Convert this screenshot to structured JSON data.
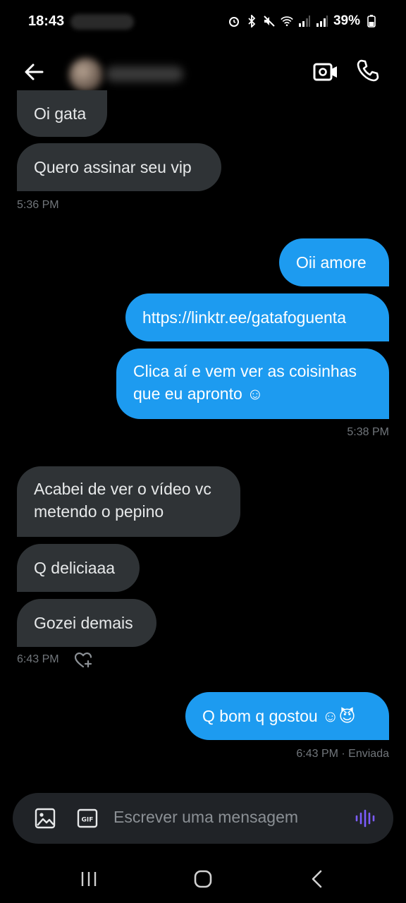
{
  "status_bar": {
    "time": "18:43",
    "battery": "39%"
  },
  "header": {
    "contact_name": ""
  },
  "messages": [
    {
      "dir": "in",
      "text": "Oi gata"
    },
    {
      "dir": "in",
      "text": "Quero assinar seu vip",
      "time": "5:36 PM"
    },
    {
      "dir": "out",
      "text": "Oii amore"
    },
    {
      "dir": "out",
      "text": "https://linktr.ee/gatafoguenta"
    },
    {
      "dir": "out",
      "lines": [
        "Clica aí e vem ver as coisinhas",
        "que eu apronto ☺"
      ],
      "time": "5:38 PM"
    },
    {
      "dir": "in",
      "lines": [
        "Acabei de ver o vídeo vc",
        "metendo o pepino"
      ]
    },
    {
      "dir": "in",
      "text": "Q deliciaaa"
    },
    {
      "dir": "in",
      "text": "Gozei demais",
      "time": "6:43 PM"
    },
    {
      "dir": "out",
      "text": "Q bom q gostou ☺😈",
      "time": "6:43 PM · Enviada"
    }
  ],
  "composer": {
    "placeholder": "Escrever uma mensagem"
  },
  "colors": {
    "incoming": "#2f3336",
    "outgoing": "#1d9bf0",
    "accent": "#7c5cff"
  },
  "icons": [
    "back-arrow-icon",
    "video-call-icon",
    "phone-icon",
    "heart-plus-icon",
    "image-icon",
    "gif-icon",
    "voice-icon",
    "recents-icon",
    "home-icon",
    "nav-back-icon"
  ]
}
